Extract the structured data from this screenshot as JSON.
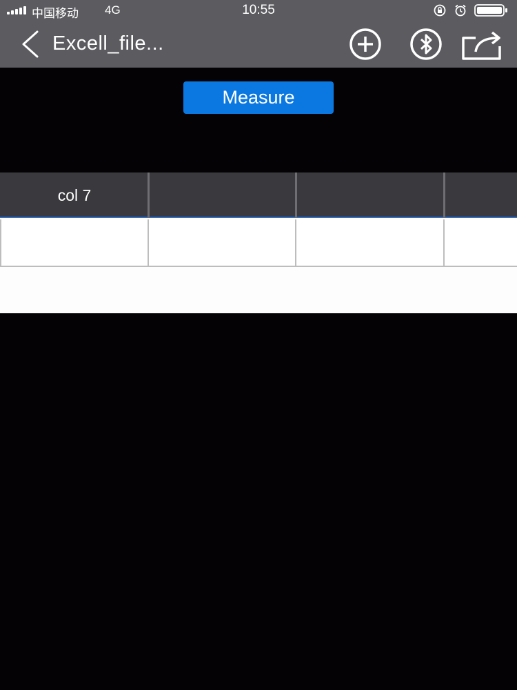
{
  "status_bar": {
    "carrier": "中国移动",
    "network": "4G",
    "time": "10:55",
    "icons": [
      "signal-icon",
      "orientation-lock-icon",
      "alarm-icon",
      "battery-icon"
    ]
  },
  "nav": {
    "title": "Excell_file...",
    "back_icon": "chevron-left-icon",
    "buttons": [
      "add-icon",
      "bluetooth-icon",
      "share-icon"
    ]
  },
  "measure_label": "Measure",
  "table": {
    "headers": [
      "col 7",
      "",
      "",
      ""
    ],
    "rows": [
      [
        "",
        "",
        "",
        ""
      ]
    ]
  },
  "colors": {
    "nav_background": "#5c5b60",
    "accent_blue": "#0b78e2",
    "table_header": "#3a393d",
    "screen_background": "#040204"
  }
}
